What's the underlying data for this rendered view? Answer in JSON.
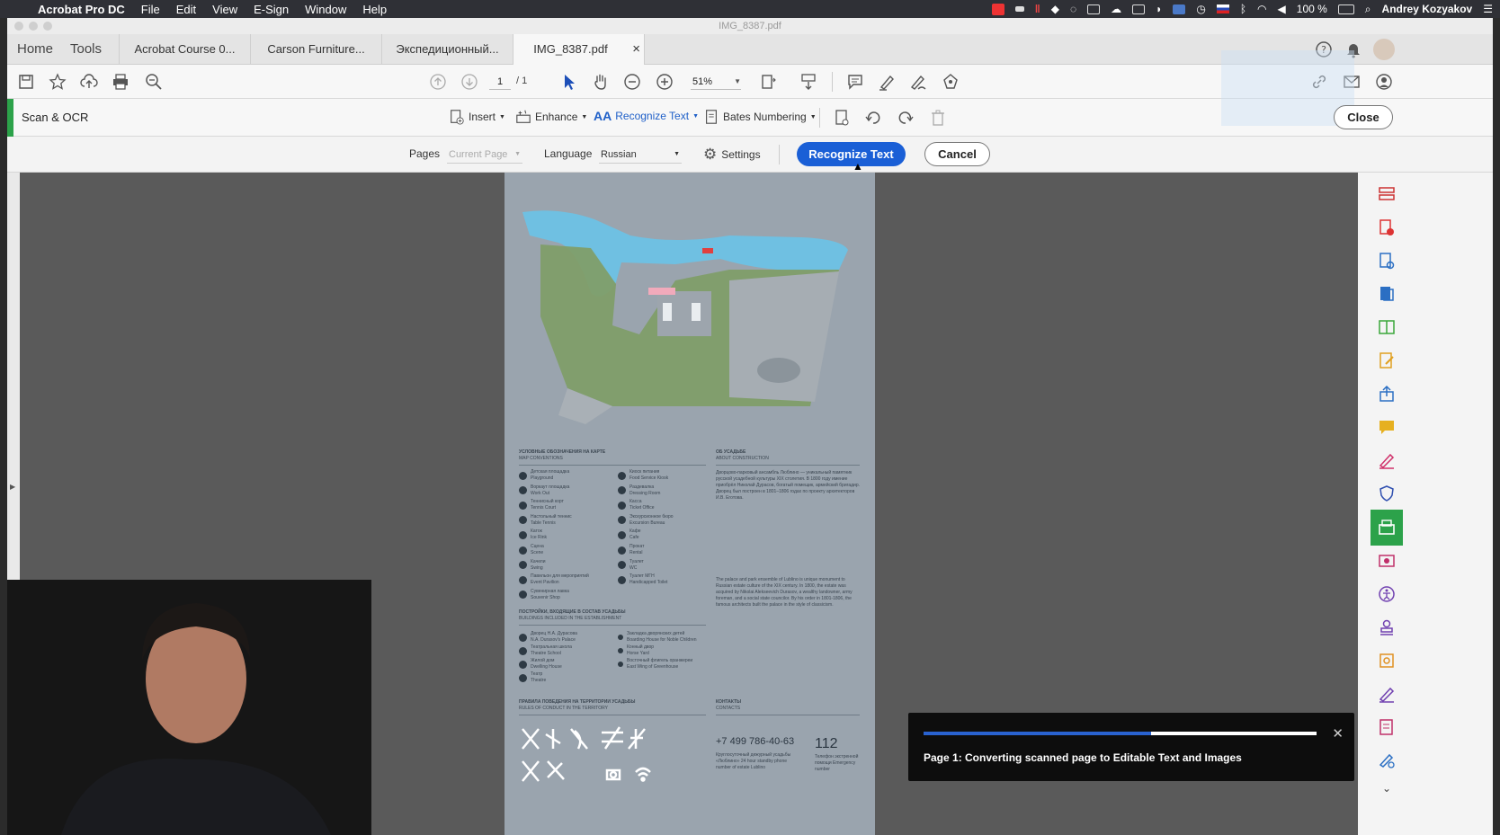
{
  "menubar": {
    "app_name": "Acrobat Pro DC",
    "items": [
      "File",
      "Edit",
      "View",
      "E-Sign",
      "Window",
      "Help"
    ],
    "battery": "100 %",
    "user": "Andrey Kozyakov"
  },
  "window": {
    "file_title": "IMG_8387.pdf"
  },
  "tabs": {
    "home": "Home",
    "tools": "Tools",
    "docs": [
      {
        "label": "Acrobat Course 0..."
      },
      {
        "label": "Carson Furniture..."
      },
      {
        "label": "Экспедиционный..."
      },
      {
        "label": "IMG_8387.pdf"
      }
    ],
    "close_glyph": "×"
  },
  "toolbar": {
    "page_current": "1",
    "page_total": "/ 1",
    "zoom": "51%"
  },
  "scanbar": {
    "title": "Scan & OCR",
    "tools": {
      "insert": "Insert",
      "enhance": "Enhance",
      "recognize": "Recognize Text",
      "bates": "Bates Numbering"
    },
    "close_label": "Close"
  },
  "options": {
    "pages_label": "Pages",
    "pages_value": "Current Page",
    "language_label": "Language",
    "language_value": "Russian",
    "settings_label": "Settings",
    "recognize_button": "Recognize Text",
    "cancel_button": "Cancel"
  },
  "progress": {
    "fraction": 0.58,
    "message": "Page 1: Converting scanned page to Editable Text and Images"
  },
  "document": {
    "map_conventions_ru": "УСЛОВНЫЕ ОБОЗНАЧЕНИЯ НА КАРТЕ",
    "map_conventions_en": "MAP CONVENTIONS",
    "about_ru": "ОБ УСАДЬБЕ",
    "about_en": "ABOUT CONSTRUCTION",
    "legend_left": [
      {
        "ru": "Детская площадка",
        "en": "Playground"
      },
      {
        "ru": "Воркаут площадка",
        "en": "Work Out"
      },
      {
        "ru": "Теннисный корт",
        "en": "Tennis Court"
      },
      {
        "ru": "Настольный теннис",
        "en": "Table Tennis"
      },
      {
        "ru": "Каток",
        "en": "Ice Rink"
      },
      {
        "ru": "Сцена",
        "en": "Scene"
      },
      {
        "ru": "Качели",
        "en": "Swing"
      },
      {
        "ru": "Павильон для мероприятий",
        "en": "Event Pavilion"
      },
      {
        "ru": "Сувенирная лавка",
        "en": "Souvenir Shop"
      }
    ],
    "legend_right": [
      {
        "ru": "Киоск питания",
        "en": "Food Service Kiosk"
      },
      {
        "ru": "Раздевалка",
        "en": "Dressing Room"
      },
      {
        "ru": "Касса",
        "en": "Ticket Office"
      },
      {
        "ru": "Экскурсионное бюро",
        "en": "Excursion Bureau"
      },
      {
        "ru": "Кафе",
        "en": "Cafe"
      },
      {
        "ru": "Прокат",
        "en": "Rental"
      },
      {
        "ru": "Туалет",
        "en": "WC"
      },
      {
        "ru": "Туалет МГН",
        "en": "Handicapped Toilet"
      }
    ],
    "about_ru_text": "Дворцово-парковый ансамбль Люблино — уникальный памятник русской усадебной культуры XIX столетия. В 1800 году имение приобрёл Николай Дурасов, богатый помещик, армейский бригадир. Дворец был построен в 1801–1806 годах по проекту архитекторов И.В. Еготова.",
    "about_en_text": "The palace and park ensemble of Lublino is unique monument to Russian estate culture of the XIX century. In 1800, the estate was acquired by Nikolai Alekseevich Durasov, a wealthy landowner, army foreman, and a social state councilor. By his order in 1801-1806, the famous architects built the palace in the style of classicism.",
    "buildings_ru": "ПОСТРОЙКИ, ВХОДЯЩИЕ В СОСТАВ УСАДЬБЫ",
    "buildings_en": "BUILDINGS INCLUDED IN THE ESTABLISHMENT",
    "buildings": [
      {
        "ru": "Дворец Н.А. Дурасова",
        "en": "N.A. Durasov's Palace"
      },
      {
        "ru": "Театральная школа",
        "en": "Theatre School"
      },
      {
        "ru": "Жилой дом",
        "en": "Dwelling House"
      },
      {
        "ru": "Театр",
        "en": "Theatre"
      },
      {
        "ru": "Закладка дворянских детей",
        "en": "Boarding House for Noble Children"
      },
      {
        "ru": "Конный двор",
        "en": "Horse Yard"
      },
      {
        "ru": "Восточный флигель оранжереи",
        "en": "East Wing of Greenhouse"
      }
    ],
    "rules_ru": "ПРАВИЛА ПОВЕДЕНИЯ НА ТЕРРИТОРИИ УСАДЬБЫ",
    "rules_en": "RULES OF CONDUCT IN THE TERRITORY",
    "contacts_ru": "КОНТАКТЫ",
    "contacts_en": "CONTACTS",
    "phone": "+7 499 786-40-63",
    "phone_note": "Круглосуточный дежурный усадьбы «Люблино» 24 hour standby phone number of estate Lublino",
    "emergency": "112",
    "emergency_note": "Телефон экстренной помощи Emergency number"
  }
}
